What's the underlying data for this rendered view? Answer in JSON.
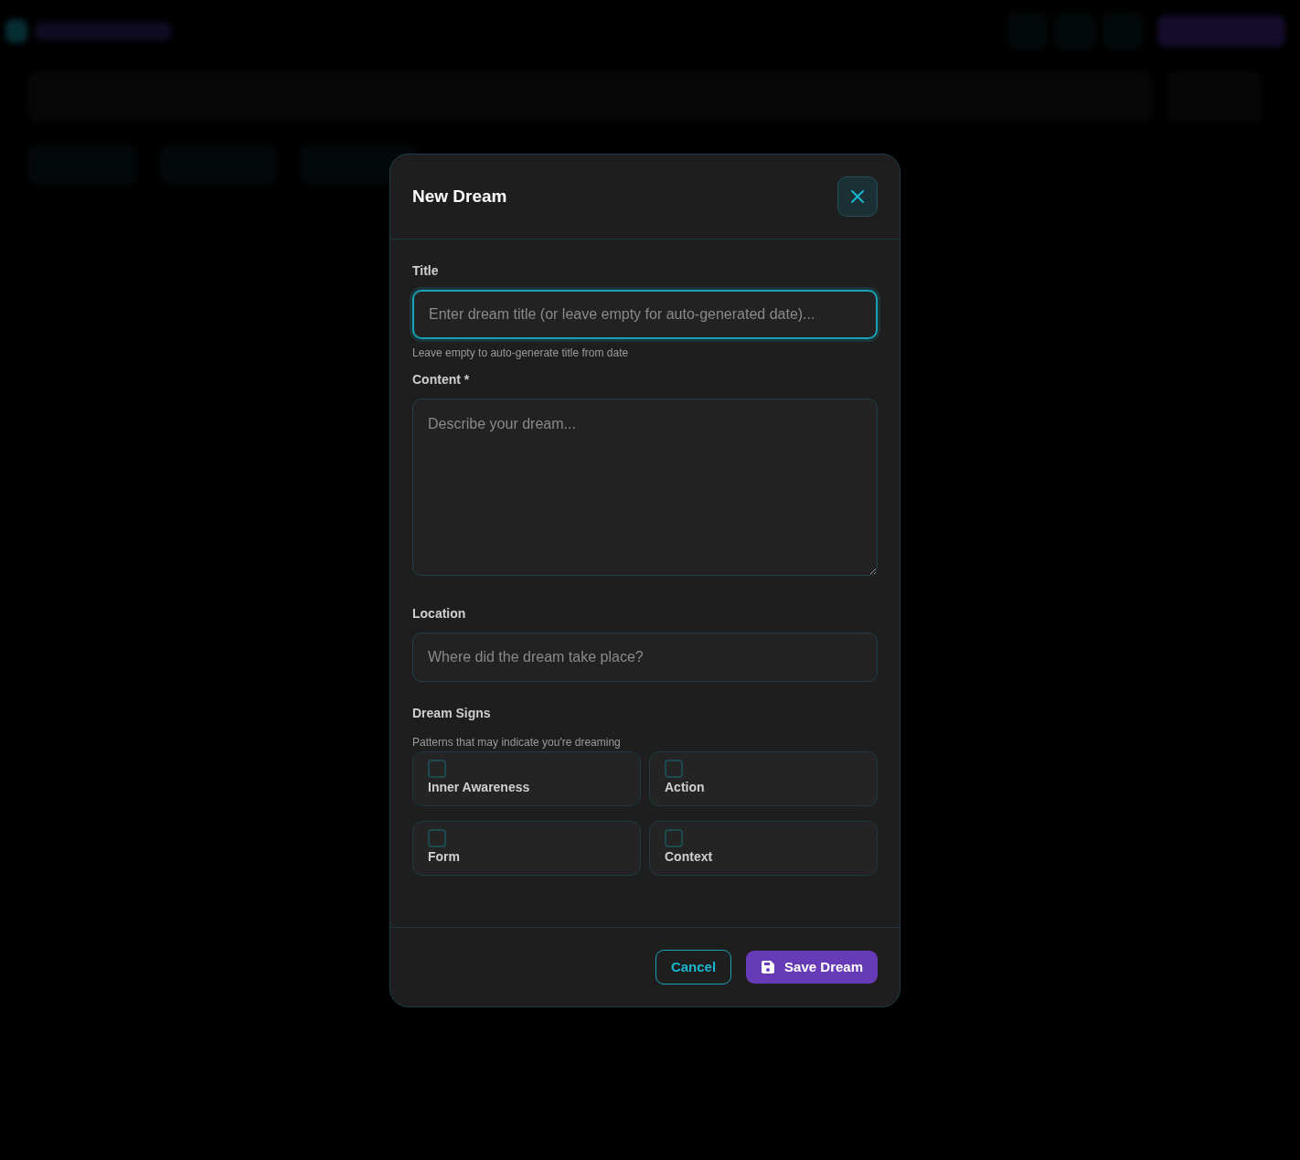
{
  "modal": {
    "title": "New Dream",
    "fields": [
      {
        "kind": "input",
        "label": "Title",
        "placeholder": "Enter dream title (or leave empty for auto-generated date)...",
        "focused": true,
        "help": "Leave empty to auto-generate title from date"
      },
      {
        "kind": "textarea",
        "label": "Content *",
        "placeholder": "Describe your dream..."
      },
      {
        "kind": "input",
        "label": "Location",
        "placeholder": "Where did the dream take place?"
      }
    ],
    "dream_signs": {
      "label": "Dream Signs",
      "help": "Patterns that may indicate you're dreaming",
      "options": [
        {
          "label": "Inner Awareness",
          "checked": false
        },
        {
          "label": "Action",
          "checked": false
        },
        {
          "label": "Form",
          "checked": false
        },
        {
          "label": "Context",
          "checked": false
        }
      ]
    },
    "buttons": [
      {
        "kind": "cancel",
        "label": "Cancel"
      },
      {
        "kind": "save",
        "label": "Save Dream"
      }
    ]
  }
}
